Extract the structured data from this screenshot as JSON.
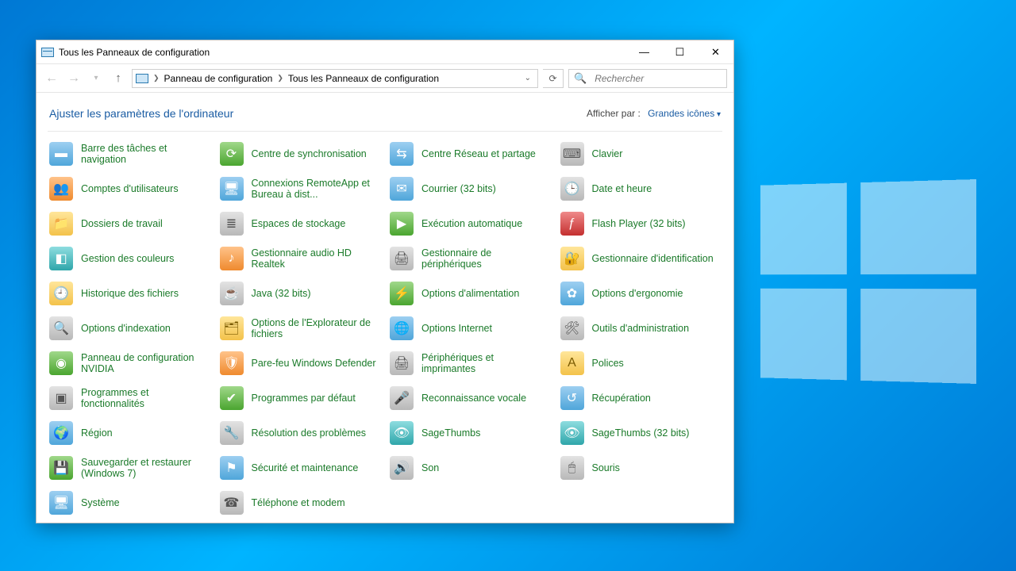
{
  "window": {
    "title": "Tous les Panneaux de configuration"
  },
  "breadcrumb": {
    "root": "Panneau de configuration",
    "current": "Tous les Panneaux de configuration"
  },
  "search": {
    "placeholder": "Rechercher"
  },
  "heading": "Ajuster les paramètres de l'ordinateur",
  "view_by_label": "Afficher par :",
  "view_by_value": "Grandes icônes",
  "items": [
    {
      "label": "Barre des tâches et navigation",
      "icon": "▬",
      "cls": "ic-blue",
      "name": "taskbar-navigation"
    },
    {
      "label": "Centre de synchronisation",
      "icon": "⟳",
      "cls": "ic-green",
      "name": "sync-center"
    },
    {
      "label": "Centre Réseau et partage",
      "icon": "⇆",
      "cls": "ic-blue",
      "name": "network-sharing-center"
    },
    {
      "label": "Clavier",
      "icon": "⌨",
      "cls": "ic-gray",
      "name": "keyboard"
    },
    {
      "label": "Comptes d'utilisateurs",
      "icon": "👥",
      "cls": "ic-orange",
      "name": "user-accounts"
    },
    {
      "label": "Connexions RemoteApp et Bureau à dist...",
      "icon": "🖥",
      "cls": "ic-blue",
      "name": "remoteapp-desktop"
    },
    {
      "label": "Courrier (32 bits)",
      "icon": "✉",
      "cls": "ic-blue",
      "name": "mail-32"
    },
    {
      "label": "Date et heure",
      "icon": "🕒",
      "cls": "ic-gray",
      "name": "date-time"
    },
    {
      "label": "Dossiers de travail",
      "icon": "📁",
      "cls": "ic-yellow",
      "name": "work-folders"
    },
    {
      "label": "Espaces de stockage",
      "icon": "≣",
      "cls": "ic-gray",
      "name": "storage-spaces"
    },
    {
      "label": "Exécution automatique",
      "icon": "▶",
      "cls": "ic-green",
      "name": "autoplay"
    },
    {
      "label": "Flash Player (32 bits)",
      "icon": "ƒ",
      "cls": "ic-red",
      "name": "flash-player-32"
    },
    {
      "label": "Gestion des couleurs",
      "icon": "◧",
      "cls": "ic-teal",
      "name": "color-management"
    },
    {
      "label": "Gestionnaire audio HD Realtek",
      "icon": "♪",
      "cls": "ic-orange",
      "name": "realtek-hd-audio"
    },
    {
      "label": "Gestionnaire de périphériques",
      "icon": "🖨",
      "cls": "ic-gray",
      "name": "device-manager"
    },
    {
      "label": "Gestionnaire d'identification",
      "icon": "🔐",
      "cls": "ic-yellow",
      "name": "credential-manager"
    },
    {
      "label": "Historique des fichiers",
      "icon": "🕘",
      "cls": "ic-yellow",
      "name": "file-history"
    },
    {
      "label": "Java (32 bits)",
      "icon": "☕",
      "cls": "ic-gray",
      "name": "java-32"
    },
    {
      "label": "Options d'alimentation",
      "icon": "⚡",
      "cls": "ic-green",
      "name": "power-options"
    },
    {
      "label": "Options d'ergonomie",
      "icon": "✿",
      "cls": "ic-blue",
      "name": "ease-of-access"
    },
    {
      "label": "Options d'indexation",
      "icon": "🔍",
      "cls": "ic-gray",
      "name": "indexing-options"
    },
    {
      "label": "Options de l'Explorateur de fichiers",
      "icon": "🗂",
      "cls": "ic-yellow",
      "name": "file-explorer-options"
    },
    {
      "label": "Options Internet",
      "icon": "🌐",
      "cls": "ic-blue",
      "name": "internet-options"
    },
    {
      "label": "Outils d'administration",
      "icon": "🛠",
      "cls": "ic-gray",
      "name": "admin-tools"
    },
    {
      "label": "Panneau de configuration NVIDIA",
      "icon": "◉",
      "cls": "ic-green",
      "name": "nvidia-control-panel"
    },
    {
      "label": "Pare-feu Windows Defender",
      "icon": "🛡",
      "cls": "ic-orange",
      "name": "windows-defender-firewall"
    },
    {
      "label": "Périphériques et imprimantes",
      "icon": "🖨",
      "cls": "ic-gray",
      "name": "devices-printers"
    },
    {
      "label": "Polices",
      "icon": "A",
      "cls": "ic-yellow",
      "name": "fonts"
    },
    {
      "label": "Programmes et fonctionnalités",
      "icon": "▣",
      "cls": "ic-gray",
      "name": "programs-features"
    },
    {
      "label": "Programmes par défaut",
      "icon": "✔",
      "cls": "ic-green",
      "name": "default-programs"
    },
    {
      "label": "Reconnaissance vocale",
      "icon": "🎤",
      "cls": "ic-gray",
      "name": "speech-recognition"
    },
    {
      "label": "Récupération",
      "icon": "↺",
      "cls": "ic-blue",
      "name": "recovery"
    },
    {
      "label": "Région",
      "icon": "🌍",
      "cls": "ic-blue",
      "name": "region"
    },
    {
      "label": "Résolution des problèmes",
      "icon": "🔧",
      "cls": "ic-gray",
      "name": "troubleshooting"
    },
    {
      "label": "SageThumbs",
      "icon": "👁",
      "cls": "ic-teal",
      "name": "sagethumbs"
    },
    {
      "label": "SageThumbs (32 bits)",
      "icon": "👁",
      "cls": "ic-teal",
      "name": "sagethumbs-32"
    },
    {
      "label": "Sauvegarder et restaurer (Windows 7)",
      "icon": "💾",
      "cls": "ic-green",
      "name": "backup-restore-win7"
    },
    {
      "label": "Sécurité et maintenance",
      "icon": "⚑",
      "cls": "ic-blue",
      "name": "security-maintenance"
    },
    {
      "label": "Son",
      "icon": "🔊",
      "cls": "ic-gray",
      "name": "sound"
    },
    {
      "label": "Souris",
      "icon": "🖱",
      "cls": "ic-gray",
      "name": "mouse"
    },
    {
      "label": "Système",
      "icon": "🖥",
      "cls": "ic-blue",
      "name": "system"
    },
    {
      "label": "Téléphone et modem",
      "icon": "☎",
      "cls": "ic-gray",
      "name": "phone-modem"
    }
  ]
}
